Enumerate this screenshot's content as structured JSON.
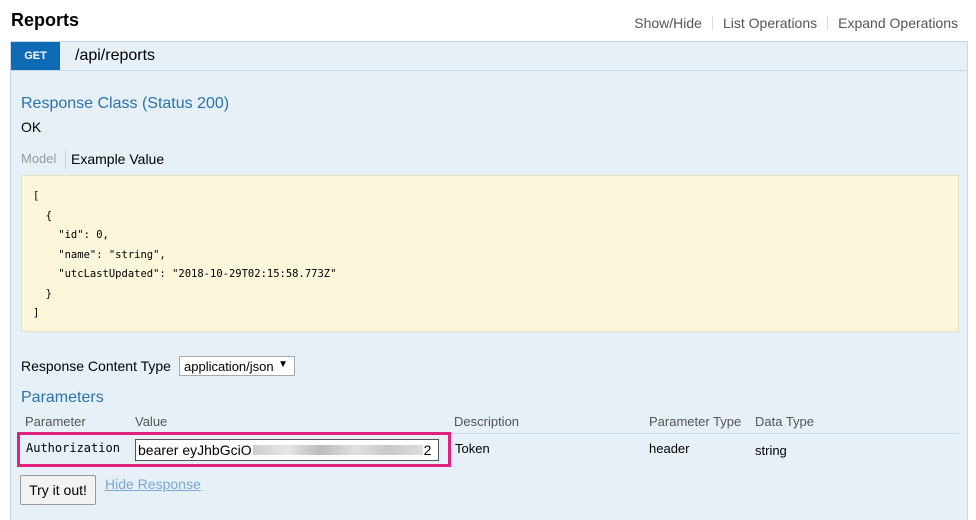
{
  "header": {
    "title": "Reports",
    "links": [
      "Show/Hide",
      "List Operations",
      "Expand Operations"
    ]
  },
  "operation": {
    "method": "GET",
    "path": "/api/reports",
    "response_class_title": "Response Class (Status 200)",
    "response_status_text": "OK",
    "tabs": {
      "model": "Model",
      "example": "Example Value"
    },
    "example_value": "[\n  {\n    \"id\": 0,\n    \"name\": \"string\",\n    \"utcLastUpdated\": \"2018-10-29T02:15:58.773Z\"\n  }\n]",
    "response_content_type_label": "Response Content Type",
    "response_content_type_value": "application/json",
    "parameters_title": "Parameters",
    "param_headers": {
      "parameter": "Parameter",
      "value": "Value",
      "description": "Description",
      "parameter_type": "Parameter Type",
      "data_type": "Data Type"
    },
    "param_row": {
      "name": "Authorization",
      "value_visible_prefix": "bearer eyJhbGciO",
      "value_visible_suffix": "2",
      "description": "Token",
      "parameter_type": "header",
      "data_type": "string"
    },
    "try_button": "Try it out!",
    "hide_response": "Hide Response"
  },
  "colors": {
    "get_badge": "#0f6ab4",
    "panel_bg": "#e7f0f7",
    "highlight_box": "#e0227f",
    "code_bg": "#fcf6db"
  }
}
